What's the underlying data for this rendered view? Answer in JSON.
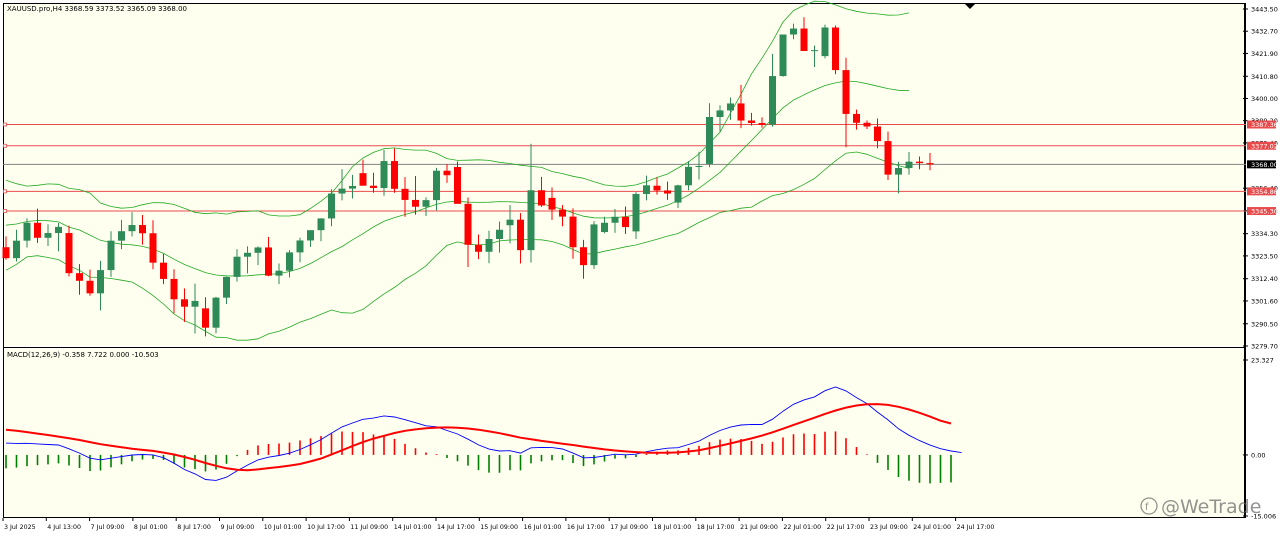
{
  "symbol_header": "XAUUSD.pro,H4  3368.59 3373.52 3365.09 3368.00",
  "watermark": "@WeTrade",
  "colors": {
    "background": "#FFFFF0",
    "bull_candle": "#2E8B57",
    "bear_candle": "#FF0000",
    "bollinger": "#22AA22",
    "hline": "#E84C4C",
    "current_price_line": "#808080",
    "macd_line": "#0000FF",
    "signal_line": "#FF0000",
    "hist_pos": "#FF0000",
    "hist_neg": "#008000"
  },
  "chart_data": [
    {
      "type": "candlestick",
      "panel": "main",
      "ylim": [
        3279.7,
        3443.5
      ],
      "y_ticks": [
        "3443.50",
        "3432.70",
        "3421.90",
        "3410.80",
        "3400.00",
        "3389.20",
        "3378.40",
        "3368.00",
        "3356.40",
        "3345.40",
        "3334.30",
        "3323.50",
        "3312.40",
        "3301.60",
        "3290.50",
        "3279.70"
      ],
      "current_price": "3368.00",
      "horizontal_lines": [
        {
          "price": 3387.36,
          "label": "3387.36"
        },
        {
          "price": 3377.02,
          "label": "3377.02"
        },
        {
          "price": 3354.86,
          "label": "3354.86"
        },
        {
          "price": 3345.3,
          "label": "3345.30"
        }
      ],
      "x_labels": [
        "3 Jul 2025",
        "4 Jul 13:00",
        "7 Jul 09:00",
        "8 Jul 01:00",
        "8 Jul 17:00",
        "9 Jul 09:00",
        "10 Jul 01:00",
        "10 Jul 17:00",
        "11 Jul 09:00",
        "14 Jul 01:00",
        "14 Jul 17:00",
        "15 Jul 09:00",
        "16 Jul 01:00",
        "16 Jul 17:00",
        "17 Jul 09:00",
        "18 Jul 01:00",
        "18 Jul 17:00",
        "21 Jul 09:00",
        "22 Jul 01:00",
        "22 Jul 17:00",
        "23 Jul 09:00",
        "24 Jul 01:00",
        "24 Jul 17:00"
      ],
      "candles": [
        [
          3327.7,
          3333.0,
          3321.7,
          3322.4
        ],
        [
          3322.4,
          3336.2,
          3320.8,
          3330.9
        ],
        [
          3330.9,
          3341.8,
          3327.6,
          3339.6
        ],
        [
          3339.6,
          3346.5,
          3329.8,
          3332.3
        ],
        [
          3332.3,
          3338.9,
          3328.3,
          3334.6
        ],
        [
          3334.6,
          3339.5,
          3325.7,
          3337.6
        ],
        [
          3334.6,
          3338.2,
          3313.5,
          3315.1
        ],
        [
          3315.1,
          3319.5,
          3304.6,
          3311.4
        ],
        [
          3311.4,
          3316.8,
          3304.1,
          3305.3
        ],
        [
          3305.3,
          3321.1,
          3297.0,
          3316.6
        ],
        [
          3316.6,
          3335.5,
          3313.3,
          3330.9
        ],
        [
          3330.9,
          3341.0,
          3326.8,
          3335.5
        ],
        [
          3335.5,
          3344.8,
          3332.9,
          3338.5
        ],
        [
          3338.5,
          3343.4,
          3329.0,
          3334.5
        ],
        [
          3334.5,
          3340.8,
          3317.0,
          3320.2
        ],
        [
          3320.2,
          3324.4,
          3309.8,
          3312.3
        ],
        [
          3312.3,
          3317.0,
          3295.6,
          3302.4
        ],
        [
          3302.4,
          3307.7,
          3291.4,
          3298.8
        ],
        [
          3298.8,
          3310.0,
          3285.8,
          3301.6
        ],
        [
          3298.0,
          3303.4,
          3284.4,
          3288.6
        ],
        [
          3288.6,
          3303.6,
          3285.9,
          3303.2
        ],
        [
          3303.2,
          3313.4,
          3300.1,
          3313.3
        ],
        [
          3313.3,
          3326.8,
          3311.0,
          3323.1
        ],
        [
          3323.1,
          3328.1,
          3315.0,
          3325.0
        ],
        [
          3325.0,
          3328.1,
          3319.0,
          3327.6
        ],
        [
          3327.6,
          3332.7,
          3313.6,
          3313.9
        ],
        [
          3313.9,
          3319.8,
          3309.8,
          3316.3
        ],
        [
          3316.3,
          3326.3,
          3313.0,
          3325.2
        ],
        [
          3325.2,
          3332.4,
          3320.4,
          3331.0
        ],
        [
          3331.0,
          3335.9,
          3327.9,
          3336.0
        ],
        [
          3336.0,
          3341.8,
          3330.6,
          3341.7
        ],
        [
          3341.7,
          3355.9,
          3337.9,
          3353.8
        ],
        [
          3353.8,
          3365.7,
          3350.5,
          3356.2
        ],
        [
          3356.2,
          3362.9,
          3351.4,
          3357.5
        ],
        [
          3363.7,
          3370.3,
          3358.2,
          3357.6
        ],
        [
          3357.6,
          3363.9,
          3354.2,
          3356.5
        ],
        [
          3356.5,
          3375.0,
          3352.7,
          3369.6
        ],
        [
          3369.6,
          3375.7,
          3354.2,
          3356.1
        ],
        [
          3356.1,
          3361.8,
          3342.5,
          3350.7
        ],
        [
          3350.7,
          3362.3,
          3343.5,
          3347.4
        ],
        [
          3347.4,
          3352.0,
          3342.9,
          3350.6
        ],
        [
          3350.6,
          3366.3,
          3345.6,
          3364.9
        ],
        [
          3364.9,
          3368.1,
          3359.0,
          3362.7
        ],
        [
          3366.7,
          3369.4,
          3349.4,
          3348.8
        ],
        [
          3348.8,
          3351.9,
          3318.1,
          3328.9
        ],
        [
          3328.9,
          3333.9,
          3321.9,
          3325.5
        ],
        [
          3325.5,
          3335.7,
          3319.9,
          3331.7
        ],
        [
          3331.7,
          3340.2,
          3325.1,
          3336.2
        ],
        [
          3338.4,
          3348.2,
          3329.6,
          3341.1
        ],
        [
          3341.1,
          3344.3,
          3319.8,
          3326.3
        ],
        [
          3326.3,
          3378.0,
          3320.2,
          3355.4
        ],
        [
          3355.4,
          3361.9,
          3347.3,
          3348.0
        ],
        [
          3351.7,
          3356.8,
          3341.0,
          3346.0
        ],
        [
          3346.0,
          3348.2,
          3337.9,
          3342.6
        ],
        [
          3342.6,
          3346.6,
          3322.1,
          3327.7
        ],
        [
          3327.7,
          3331.3,
          3312.4,
          3319.0
        ],
        [
          3319.0,
          3340.4,
          3317.2,
          3338.8
        ],
        [
          3335.1,
          3342.5,
          3334.5,
          3339.6
        ],
        [
          3339.6,
          3346.3,
          3334.7,
          3342.5
        ],
        [
          3342.5,
          3347.5,
          3334.2,
          3337.5
        ],
        [
          3335.4,
          3354.5,
          3331.7,
          3353.6
        ],
        [
          3353.6,
          3362.5,
          3350.5,
          3357.8
        ],
        [
          3357.6,
          3361.6,
          3353.3,
          3355.3
        ],
        [
          3355.3,
          3359.6,
          3350.7,
          3353.8
        ],
        [
          3349.4,
          3358.1,
          3346.7,
          3357.8
        ],
        [
          3357.8,
          3369.6,
          3355.4,
          3366.8
        ],
        [
          3366.8,
          3374.1,
          3360.6,
          3367.2
        ],
        [
          3368.2,
          3397.7,
          3366.6,
          3391.0
        ],
        [
          3391.0,
          3396.7,
          3383.9,
          3394.2
        ],
        [
          3394.2,
          3400.5,
          3389.6,
          3397.6
        ],
        [
          3397.6,
          3406.6,
          3385.6,
          3389.3
        ],
        [
          3389.3,
          3393.0,
          3386.8,
          3388.1
        ],
        [
          3388.1,
          3390.9,
          3385.8,
          3387.2
        ],
        [
          3387.3,
          3421.6,
          3386.3,
          3410.9
        ],
        [
          3410.9,
          3429.4,
          3410.6,
          3431.1
        ],
        [
          3431.1,
          3436.4,
          3428.8,
          3434.0
        ],
        [
          3434.0,
          3439.5,
          3423.1,
          3423.1
        ],
        [
          3423.1,
          3425.7,
          3415.3,
          3423.5
        ],
        [
          3420.6,
          3435.9,
          3419.5,
          3434.5
        ],
        [
          3434.5,
          3435.4,
          3411.8,
          3413.8
        ],
        [
          3413.8,
          3419.8,
          3376.3,
          3392.5
        ],
        [
          3392.5,
          3394.6,
          3384.9,
          3388.2
        ],
        [
          3388.2,
          3389.3,
          3385.2,
          3386.4
        ],
        [
          3386.4,
          3390.3,
          3375.8,
          3379.3
        ],
        [
          3379.3,
          3383.9,
          3360.4,
          3363.0
        ],
        [
          3363.0,
          3369.2,
          3353.9,
          3366.2
        ],
        [
          3366.2,
          3374.0,
          3363.0,
          3369.3
        ],
        [
          3369.3,
          3371.8,
          3365.6,
          3368.6
        ],
        [
          3368.6,
          3373.5,
          3365.1,
          3368.0
        ]
      ],
      "bollinger_upper": [
        3360.3,
        3358.6,
        3357.4,
        3357.8,
        3358.5,
        3358.3,
        3356.3,
        3355.7,
        3354.0,
        3349.2,
        3347.5,
        3346.7,
        3347.0,
        3348.4,
        3349.4,
        3349.3,
        3348.5,
        3346.6,
        3344.7,
        3344.0,
        3344.4,
        3343.8,
        3344.9,
        3345.1,
        3345.4,
        3343.4,
        3342.9,
        3342.9,
        3343.5,
        3346.6,
        3350.1,
        3354.0,
        3360.1,
        3366.9,
        3371.1,
        3373.8,
        3375.6,
        3376.0,
        3375.2,
        3374.9,
        3374.9,
        3373.3,
        3370.8,
        3369.9,
        3370.0,
        3370.2,
        3369.9,
        3369.0,
        3368.4,
        3367.6,
        3367.0,
        3366.5,
        3364.5,
        3363.5,
        3362.2,
        3361.2,
        3359.5,
        3358.0,
        3357.4,
        3357.3,
        3358.0,
        3359.6,
        3361.6,
        3363.3,
        3366.2,
        3369.2,
        3373.0,
        3378.3,
        3383.6,
        3392.9,
        3402.1,
        3412.0,
        3419.6,
        3427.8,
        3437.2,
        3442.7,
        3445.3,
        3447.3,
        3447.1,
        3445.5,
        3443.6,
        3442.4,
        3441.5,
        3441.1,
        3440.5,
        3440.6,
        3441.6
      ],
      "bollinger_middle": [
        3338.4,
        3339.0,
        3340.2,
        3340.7,
        3340.6,
        3340.0,
        3337.5,
        3336.1,
        3333.6,
        3331.1,
        3330.0,
        3329.2,
        3328.9,
        3328.1,
        3326.8,
        3324.7,
        3321.9,
        3319.3,
        3317.3,
        3315.4,
        3314.2,
        3313.8,
        3313.7,
        3313.8,
        3314.3,
        3314.5,
        3314.9,
        3315.9,
        3317.4,
        3319.8,
        3322.6,
        3325.6,
        3328.0,
        3331.3,
        3334.3,
        3337.6,
        3340.3,
        3342.1,
        3343.6,
        3345.0,
        3346.8,
        3348.6,
        3349.7,
        3350.1,
        3349.6,
        3349.5,
        3349.6,
        3349.9,
        3349.8,
        3349.5,
        3349.2,
        3348.9,
        3347.5,
        3346.2,
        3344.4,
        3342.8,
        3342.0,
        3341.9,
        3342.1,
        3342.6,
        3343.4,
        3344.9,
        3346.6,
        3348.2,
        3350.3,
        3353.1,
        3356.4,
        3360.2,
        3364.1,
        3369.2,
        3374.4,
        3379.6,
        3384.9,
        3390.3,
        3395.5,
        3399.2,
        3401.8,
        3404.2,
        3406.3,
        3407.6,
        3408.5,
        3408.2,
        3407.2,
        3406.0,
        3404.8,
        3404.0,
        3403.8
      ],
      "bollinger_lower": [
        3316.5,
        3319.4,
        3323.0,
        3323.6,
        3322.7,
        3321.7,
        3318.7,
        3316.5,
        3313.2,
        3313.0,
        3312.5,
        3311.7,
        3310.8,
        3307.8,
        3304.2,
        3300.1,
        3295.3,
        3292.0,
        3289.9,
        3286.8,
        3284.0,
        3283.8,
        3282.5,
        3282.5,
        3283.2,
        3285.6,
        3286.9,
        3288.9,
        3291.3,
        3293.0,
        3295.1,
        3297.2,
        3295.9,
        3295.7,
        3297.5,
        3301.4,
        3305.0,
        3308.2,
        3312.0,
        3315.1,
        3318.7,
        3323.9,
        3328.6,
        3330.3,
        3329.2,
        3328.8,
        3329.3,
        3330.8,
        3331.2,
        3331.4,
        3331.4,
        3331.3,
        3330.5,
        3328.9,
        3326.6,
        3324.4,
        3324.5,
        3325.8,
        3326.8,
        3327.9,
        3328.8,
        3330.2,
        3331.6,
        3333.1,
        3334.4,
        3337.0,
        3339.8,
        3342.1,
        3344.6,
        3345.5,
        3346.7,
        3347.2,
        3350.2,
        3352.8,
        3353.8,
        3355.7,
        3358.3,
        3361.1,
        3365.5,
        3369.7,
        3373.4,
        3374.0,
        3372.9,
        3370.9,
        3369.1,
        3367.4,
        3366.0
      ]
    },
    {
      "type": "macd",
      "panel": "indicator",
      "title": "MACD(12,26,9) -0.358 7.722 0.000 -10.503",
      "ylim": [
        -15.006,
        23.327
      ],
      "y_ticks": [
        "23.327",
        "0.00",
        "-15.006"
      ],
      "macd_line": [
        2.9,
        2.84,
        2.86,
        2.72,
        2.57,
        2.43,
        1.51,
        0.45,
        -0.81,
        -1.2,
        -0.81,
        -0.41,
        -0.01,
        0.1,
        0.0,
        -0.67,
        -2.04,
        -3.58,
        -4.67,
        -6.04,
        -6.26,
        -5.46,
        -3.92,
        -2.5,
        -1.21,
        -0.55,
        -0.15,
        0.42,
        1.33,
        2.48,
        3.76,
        5.37,
        6.9,
        7.85,
        8.76,
        9.04,
        9.6,
        9.33,
        8.65,
        7.93,
        7.17,
        6.91,
        6.0,
        5.14,
        3.87,
        2.46,
        1.44,
        0.96,
        1.04,
        0.45,
        1.75,
        1.86,
        1.8,
        1.46,
        0.46,
        -0.71,
        -0.62,
        -0.25,
        0.17,
        0.03,
        0.18,
        0.8,
        1.28,
        1.66,
        1.77,
        2.57,
        3.39,
        4.81,
        6.01,
        6.84,
        7.36,
        7.51,
        7.47,
        8.79,
        10.74,
        12.45,
        13.52,
        14.27,
        15.79,
        16.69,
        15.74,
        14.08,
        12.62,
        10.52,
        8.61,
        6.41,
        4.83,
        3.52,
        2.41,
        1.54,
        0.97,
        0.58
      ],
      "signal_line": [
        6.2,
        5.95,
        5.62,
        5.24,
        4.89,
        4.51,
        4.1,
        3.66,
        3.15,
        2.63,
        2.24,
        1.9,
        1.54,
        1.24,
        0.99,
        0.57,
        0.11,
        -0.5,
        -1.19,
        -1.98,
        -2.66,
        -3.28,
        -3.63,
        -3.74,
        -3.55,
        -3.24,
        -2.96,
        -2.61,
        -2.24,
        -1.59,
        -0.88,
        0.12,
        1.15,
        2.19,
        3.15,
        4.01,
        4.71,
        5.38,
        5.92,
        6.28,
        6.56,
        6.71,
        6.76,
        6.7,
        6.5,
        6.19,
        5.79,
        5.34,
        4.81,
        4.24,
        3.83,
        3.44,
        3.12,
        2.75,
        2.45,
        2.04,
        1.7,
        1.37,
        1.08,
        0.87,
        0.7,
        0.56,
        0.52,
        0.55,
        0.63,
        0.84,
        1.16,
        1.67,
        2.24,
        2.84,
        3.45,
        4.06,
        4.74,
        5.56,
        6.45,
        7.37,
        8.26,
        9.14,
        10.08,
        10.92,
        11.62,
        12.15,
        12.45,
        12.48,
        12.29,
        11.83,
        11.16,
        10.36,
        9.41,
        8.4,
        7.72
      ],
      "histogram": [
        -3.3,
        -3.11,
        -2.76,
        -2.52,
        -2.32,
        -2.08,
        -2.59,
        -3.21,
        -3.96,
        -3.83,
        -3.05,
        -2.31,
        -1.55,
        -1.14,
        -0.99,
        -1.24,
        -2.15,
        -3.08,
        -3.48,
        -4.06,
        -3.6,
        -2.18,
        -0.29,
        1.24,
        2.34,
        2.69,
        2.81,
        3.03,
        3.57,
        4.07,
        4.64,
        5.25,
        5.75,
        5.66,
        5.61,
        5.03,
        4.89,
        3.95,
        2.73,
        1.65,
        0.61,
        0.2,
        -0.76,
        -1.56,
        -2.63,
        -3.73,
        -4.35,
        -4.38,
        -3.77,
        -3.79,
        -2.08,
        -1.58,
        -1.32,
        -1.29,
        -1.99,
        -2.75,
        -2.32,
        -1.62,
        -0.91,
        -0.84,
        -0.52,
        0.24,
        0.76,
        1.11,
        1.14,
        1.73,
        2.23,
        3.14,
        3.77,
        4.0,
        3.91,
        3.45,
        2.73,
        3.23,
        4.29,
        5.08,
        5.26,
        5.13,
        5.71,
        5.77,
        4.12,
        1.93,
        0.17,
        -1.96,
        -3.68,
        -5.42,
        -6.33,
        -6.84,
        -7.0,
        -6.86,
        -6.75
      ]
    }
  ]
}
